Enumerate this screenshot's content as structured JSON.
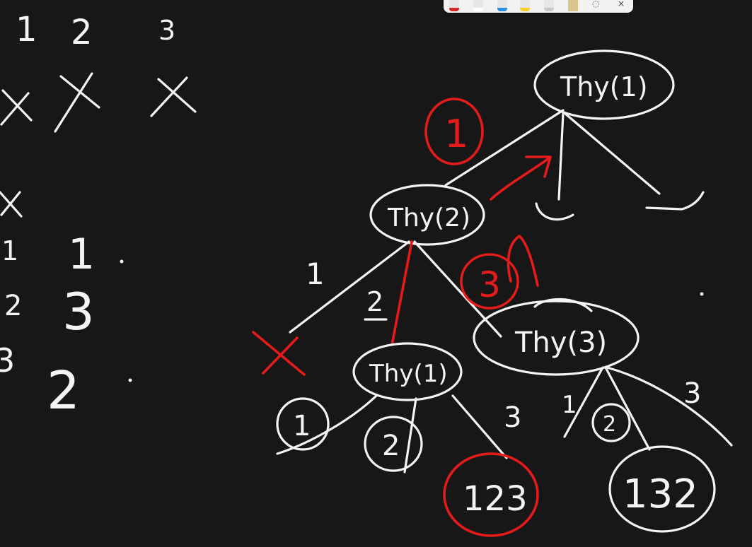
{
  "toolbar": {
    "tools": [
      {
        "name": "red-pen",
        "color": "#d62a2a"
      },
      {
        "name": "white-pen",
        "color": "#ffffff"
      },
      {
        "name": "blue-pen",
        "color": "#2f8fd8"
      },
      {
        "name": "yellow-highlighter",
        "color": "#f2d22b"
      },
      {
        "name": "pencil",
        "color": "#c9c9c9"
      }
    ],
    "close_glyph": "×",
    "lasso_glyph": "◌"
  },
  "left_notes": {
    "row1": [
      "1",
      "2",
      "3"
    ],
    "row2": [
      "x",
      "x",
      "x"
    ],
    "col_x": "x",
    "col_a": [
      "1",
      "2",
      "3"
    ],
    "col_b": [
      "1",
      "3",
      "2"
    ]
  },
  "tree": {
    "root_label": "Thy(1)",
    "node_left": "Thy(2)",
    "node_mid": "Thy(1)",
    "node_right": "Thy(3)",
    "edge_labels": {
      "root_edge": "1",
      "left_1": "1",
      "left_2": "2",
      "left_3": "3",
      "mid_3": "3",
      "right_1": "1",
      "right_3": "3"
    },
    "leaf_mid_1": "1",
    "leaf_mid_2": "2",
    "leaf_right_2": "2",
    "result_left": "123",
    "result_right": "132"
  },
  "colors": {
    "background": "#171717",
    "ink_white": "#f4f4f4",
    "ink_red": "#e41b1b"
  }
}
